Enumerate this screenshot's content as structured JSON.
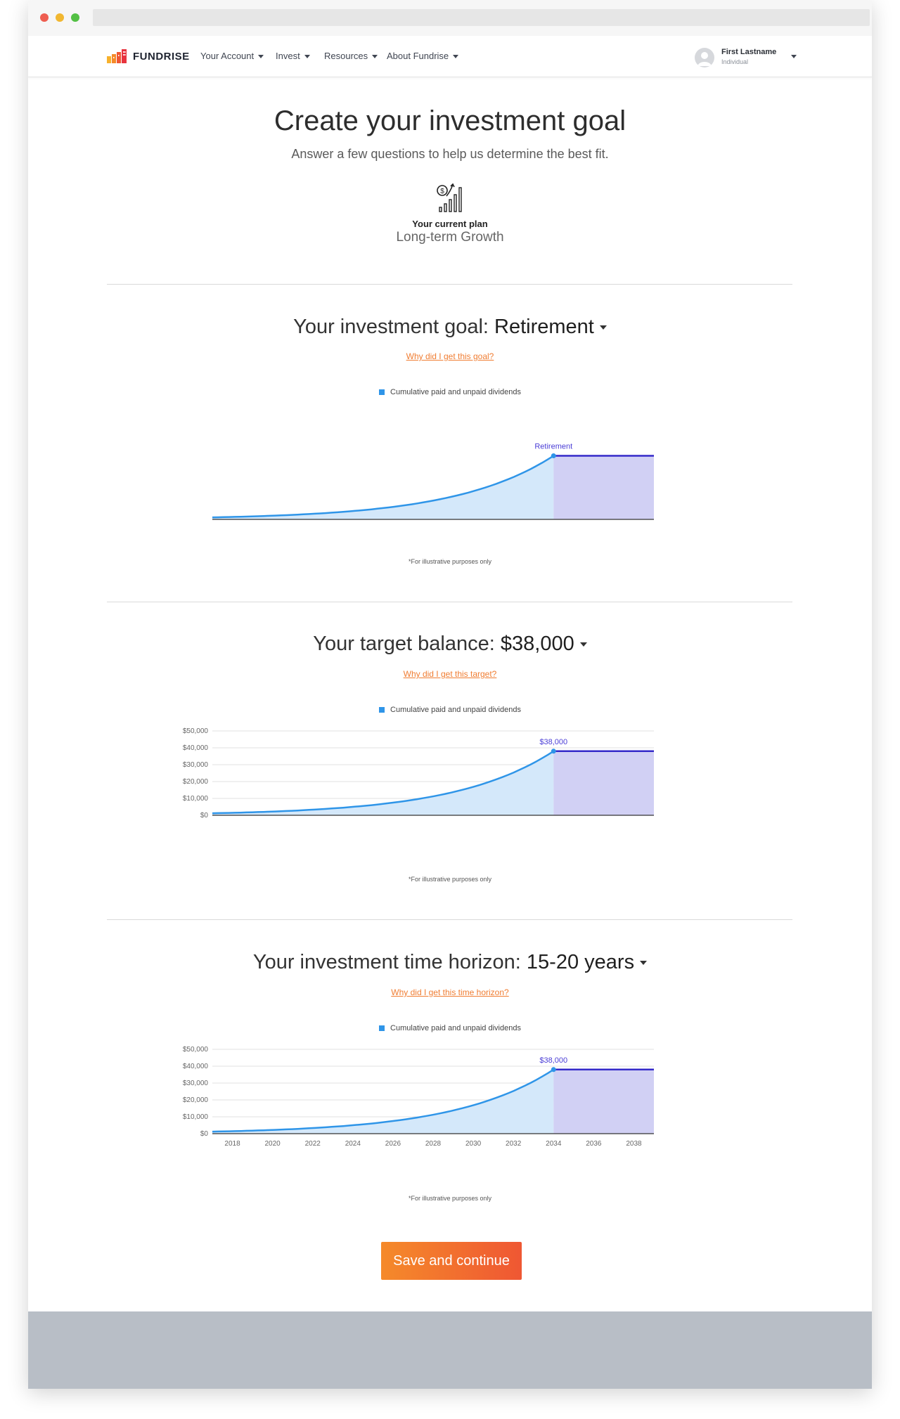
{
  "nav": {
    "logo_text": "FUNDRISE",
    "items": [
      {
        "label": "Your Account"
      },
      {
        "label": "Invest"
      },
      {
        "label": "Resources"
      },
      {
        "label": "About Fundrise"
      }
    ],
    "user": {
      "name": "First Lastname",
      "type": "Individual"
    }
  },
  "header": {
    "title": "Create your investment goal",
    "subtitle": "Answer a few questions to help us determine the best fit.",
    "plan_label": "Your current plan",
    "plan_value": "Long-term Growth",
    "plan_icon": "growth-chart-icon"
  },
  "goal": {
    "prefix": "Your investment goal: ",
    "value": "Retirement",
    "why_link": "Why did I get this goal?"
  },
  "target": {
    "prefix": "Your target balance: ",
    "value": "$38,000",
    "why_link": "Why did I get this target?"
  },
  "horizon": {
    "prefix": "Your investment time horizon: ",
    "value": "15-20 years",
    "why_link": "Why did I get this time horizon?"
  },
  "chart_legend": "Cumulative paid and unpaid dividends",
  "chart_note": "*For illustrative purposes only",
  "save_button": "Save and continue",
  "colors": {
    "accent": "#f07d32",
    "line": "#2f95e8",
    "fill": "#d4e8fa",
    "goal_region": "#d1d0f4",
    "goal_line": "#3429c9"
  },
  "chart_data": [
    {
      "type": "area",
      "legend": "Cumulative paid and unpaid dividends",
      "annotation": "Retirement",
      "x": [
        2017,
        2034
      ],
      "goal_x_range": [
        2034,
        2039
      ],
      "y_start": 1200,
      "y_end": 38000,
      "ylim": [
        0,
        50000
      ],
      "show_axes": false
    },
    {
      "type": "area",
      "legend": "Cumulative paid and unpaid dividends",
      "annotation": "$38,000",
      "y_ticks": [
        "$0",
        "$10,000",
        "$20,000",
        "$30,000",
        "$40,000",
        "$50,000"
      ],
      "ylim": [
        0,
        50000
      ],
      "y_start": 1200,
      "y_end": 38000,
      "x": [
        2017,
        2034
      ],
      "goal_x_range": [
        2034,
        2039
      ],
      "grid": true
    },
    {
      "type": "area",
      "legend": "Cumulative paid and unpaid dividends",
      "annotation": "$38,000",
      "y_ticks": [
        "$0",
        "$10,000",
        "$20,000",
        "$30,000",
        "$40,000",
        "$50,000"
      ],
      "x_ticks": [
        "2018",
        "2020",
        "2022",
        "2024",
        "2026",
        "2028",
        "2030",
        "2032",
        "2034",
        "2036",
        "2038"
      ],
      "ylim": [
        0,
        50000
      ],
      "y_start": 1200,
      "y_end": 38000,
      "x": [
        2017,
        2034
      ],
      "goal_x_range": [
        2034,
        2039
      ],
      "grid": true
    }
  ]
}
